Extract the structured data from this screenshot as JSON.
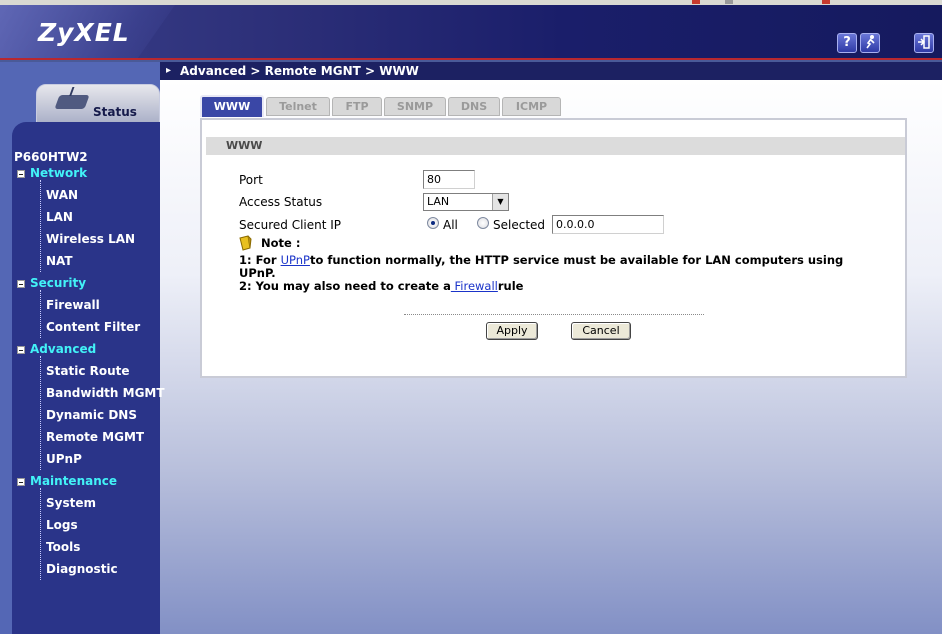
{
  "brand": {
    "logo": "ZyXEL"
  },
  "header_buttons": [
    {
      "icon": "help-icon",
      "label": "?"
    },
    {
      "icon": "wizard-icon",
      "label": ""
    },
    {
      "icon": "logout-icon",
      "label": ""
    }
  ],
  "breadcrumb": "Advanced > Remote MGNT > WWW",
  "sidebar": {
    "status_tab": "Status",
    "model": "P660HTW2",
    "sections": [
      {
        "label": "Network",
        "items": [
          "WAN",
          "LAN",
          "Wireless LAN",
          "NAT"
        ]
      },
      {
        "label": "Security",
        "items": [
          "Firewall",
          "Content Filter"
        ]
      },
      {
        "label": "Advanced",
        "items": [
          "Static Route",
          "Bandwidth MGMT",
          "Dynamic DNS",
          "Remote MGMT",
          "UPnP"
        ]
      },
      {
        "label": "Maintenance",
        "items": [
          "System",
          "Logs",
          "Tools",
          "Diagnostic"
        ]
      }
    ]
  },
  "tabs": [
    "WWW",
    "Telnet",
    "FTP",
    "SNMP",
    "DNS",
    "ICMP"
  ],
  "active_tab": "WWW",
  "form": {
    "section_title": "WWW",
    "port_label": "Port",
    "port_value": "80",
    "access_status_label": "Access Status",
    "access_status_value": "LAN",
    "secured_client_label": "Secured Client IP",
    "radio_all": "All",
    "radio_selected": "Selected",
    "radio_checked": "All",
    "secured_ip_value": "0.0.0.0",
    "note_title": "Note :",
    "note1_prefix": "1: For ",
    "note1_link": "UPnP",
    "note1_suffix": "to function normally, the HTTP service must be available for LAN computers using UPnP.",
    "note2_prefix": "2: You may also need to create a",
    "note2_link": " Firewall",
    "note2_suffix": "rule",
    "apply_label": "Apply",
    "cancel_label": "Cancel"
  },
  "colors": {
    "header": "#1a1e6a",
    "accent_red": "#b8282f",
    "category_cyan": "#42f2f7",
    "sidebar": "#2a3489",
    "active_tab": "#3a47a6"
  }
}
